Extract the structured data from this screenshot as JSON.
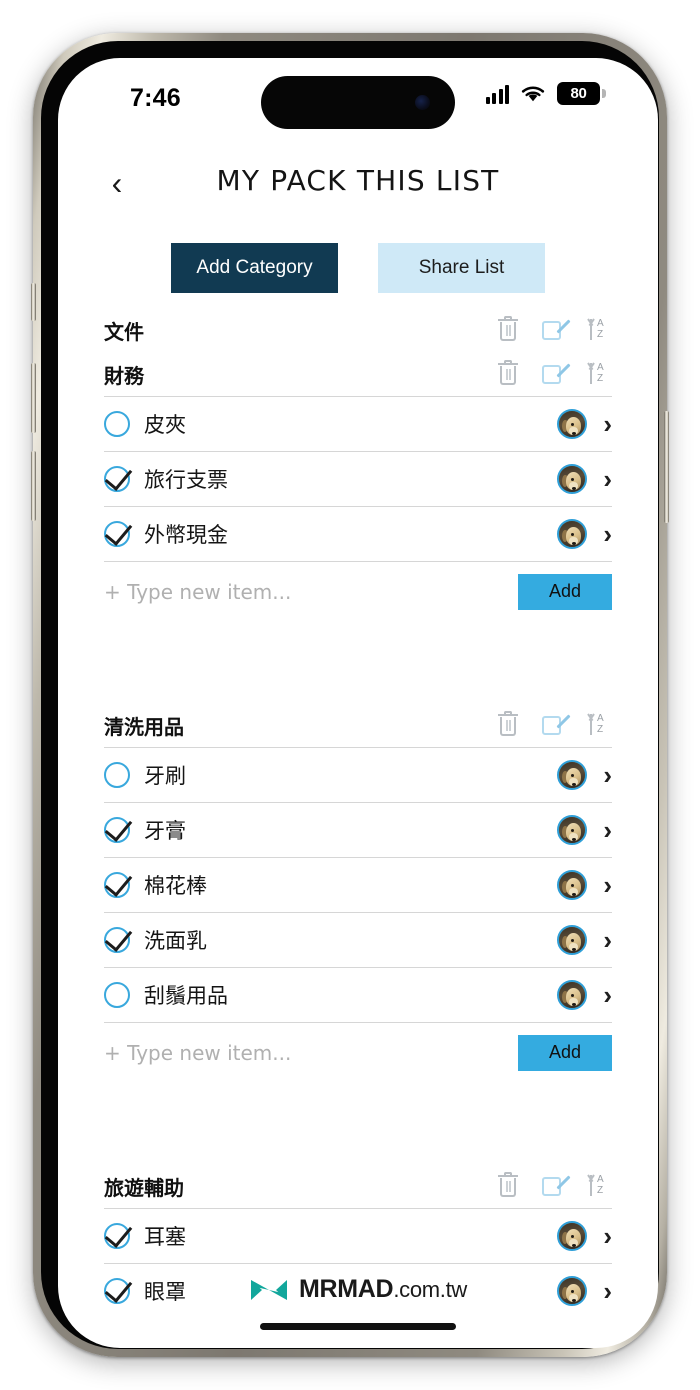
{
  "status_bar": {
    "time": "7:46",
    "signal_icon": "cellular-signal-icon",
    "wifi_icon": "wifi-icon",
    "battery_level": "80"
  },
  "header": {
    "back_icon": "‹",
    "title": "MY PACK THIS LIST"
  },
  "toolbar": {
    "add_category_label": "Add Category",
    "share_list_label": "Share List",
    "add_category_color": "#113a52",
    "share_list_color": "#cfe9f7"
  },
  "row_icons": {
    "trash": "trash-icon",
    "edit": "edit-icon",
    "sort": "sort-az-icon",
    "sort_letters_top": "A",
    "sort_letters_bottom": "Z"
  },
  "new_item": {
    "placeholder": "+ Type new item...",
    "add_label": "Add",
    "add_color": "#34abe0"
  },
  "accent_colors": {
    "checkbox_ring": "#39a8dd",
    "avatar_ring": "#2e9fd8",
    "divider": "#d6d6d6"
  },
  "categories": [
    {
      "name": "文件",
      "items": []
    },
    {
      "name": "財務",
      "items": [
        {
          "label": "皮夾",
          "checked": false
        },
        {
          "label": "旅行支票",
          "checked": true
        },
        {
          "label": "外幣現金",
          "checked": true
        }
      ],
      "has_new_item_row": true
    },
    {
      "name": "清洗用品",
      "items": [
        {
          "label": "牙刷",
          "checked": false
        },
        {
          "label": "牙膏",
          "checked": true
        },
        {
          "label": "棉花棒",
          "checked": true
        },
        {
          "label": "洗面乳",
          "checked": true
        },
        {
          "label": "刮鬚用品",
          "checked": false
        }
      ],
      "has_new_item_row": true
    },
    {
      "name": "旅遊輔助",
      "items": [
        {
          "label": "耳塞",
          "checked": true
        },
        {
          "label": "眼罩",
          "checked": true
        }
      ],
      "has_new_item_row": false
    }
  ],
  "watermark": {
    "brand": "MRMAD",
    "tld": ".com.tw",
    "logo_color": "#12a79c"
  }
}
